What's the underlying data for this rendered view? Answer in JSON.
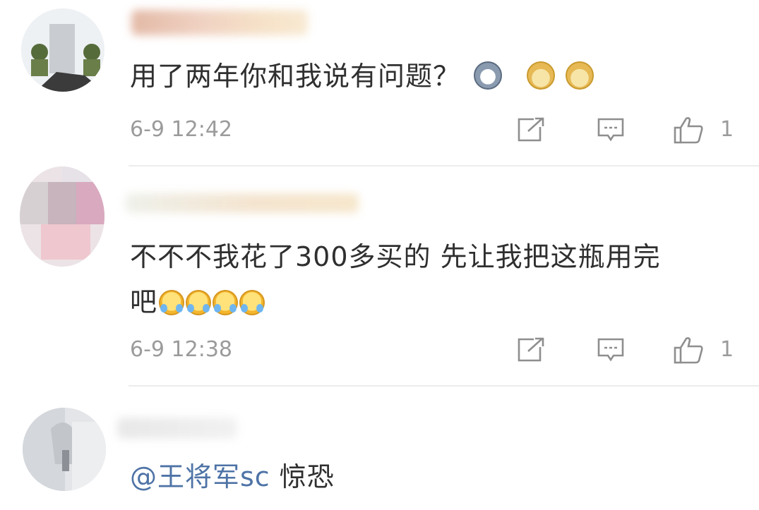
{
  "comments": [
    {
      "text": "用了两年你和我说有问题？",
      "emojis": [
        "husky-emoji",
        "doge-emoji",
        "doge-emoji"
      ],
      "time": "6-9 12:42",
      "likes": "1"
    },
    {
      "text_line1": "不不不我花了300多买的 先让我把这瓶用完",
      "text_line2": "吧",
      "emojis": [
        "cry-laugh-emoji",
        "cry-laugh-emoji",
        "cry-laugh-emoji",
        "cry-laugh-emoji"
      ],
      "time": "6-9 12:38",
      "likes": "1"
    },
    {
      "mention": "@王将军sc",
      "text": " 惊恐"
    }
  ],
  "colors": {
    "mention": "#4e73a6",
    "meta_gray": "#9b9b9b",
    "divider": "#ececec"
  },
  "icons": [
    "share-icon",
    "comment-icon",
    "like-icon"
  ]
}
